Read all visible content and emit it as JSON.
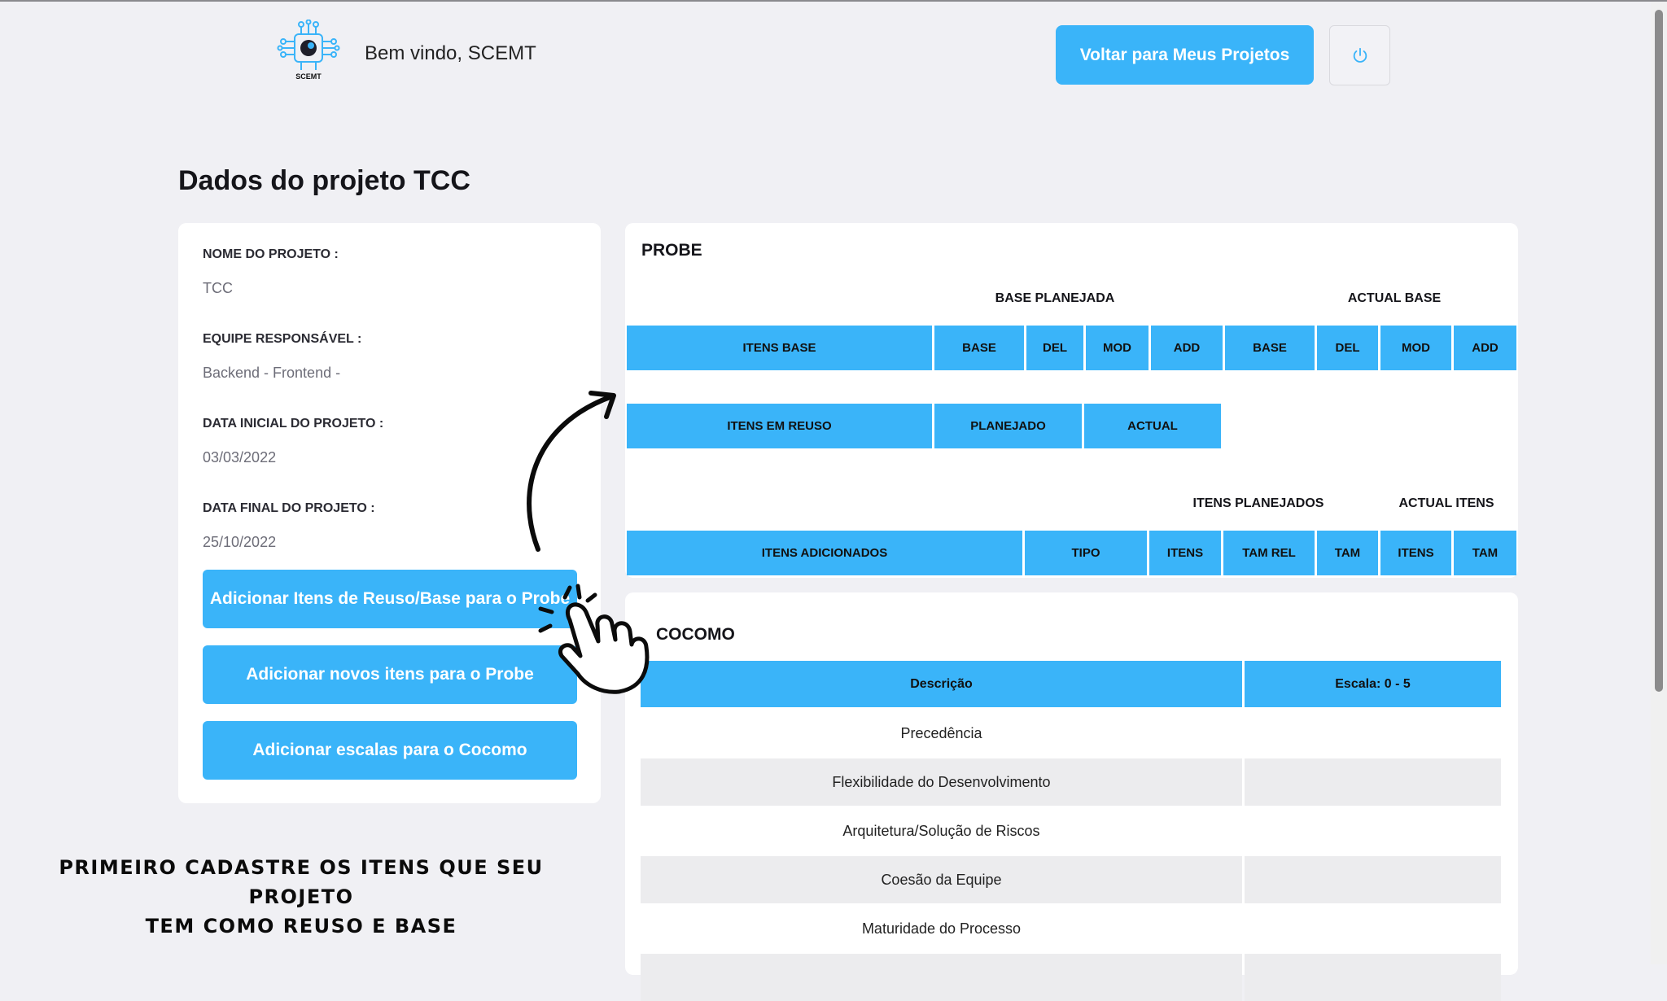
{
  "header": {
    "logo_text": "SCEMT",
    "welcome": "Bem vindo, SCEMT",
    "back_button": "Voltar para Meus Projetos",
    "power_icon": "power-icon"
  },
  "page": {
    "title": "Dados do projeto TCC"
  },
  "project": {
    "name_label": "NOME DO PROJETO :",
    "name_value": "TCC",
    "team_label": "EQUIPE RESPONSÁVEL :",
    "team_value": "Backend - Frontend -",
    "start_label": "DATA INICIAL DO PROJETO :",
    "start_value": "03/03/2022",
    "end_label": "DATA FINAL DO PROJETO :",
    "end_value": "25/10/2022",
    "buttons": {
      "reuse_base": "Adicionar Itens de Reuso/Base para o Probe",
      "new_items": "Adicionar novos itens para o Probe",
      "cocomo_scales": "Adicionar escalas para o Cocomo"
    }
  },
  "probe": {
    "title": "PROBE",
    "base_group_planned": "BASE PLANEJADA",
    "base_group_actual": "ACTUAL BASE",
    "base_headers": [
      "ITENS BASE",
      "BASE",
      "DEL",
      "MOD",
      "ADD",
      "BASE",
      "DEL",
      "MOD",
      "ADD"
    ],
    "reuse_headers": [
      "ITENS EM REUSO",
      "PLANEJADO",
      "ACTUAL"
    ],
    "added_group_planned": "ITENS PLANEJADOS",
    "added_group_actual": "ACTUAL ITENS",
    "added_headers": [
      "ITENS ADICIONADOS",
      "TIPO",
      "ITENS",
      "TAM REL",
      "TAM",
      "ITENS",
      "TAM"
    ]
  },
  "cocomo": {
    "title": "COCOMO",
    "headers": [
      "Descrição",
      "Escala: 0 - 5"
    ],
    "rows": [
      {
        "description": "Precedência",
        "scale": ""
      },
      {
        "description": "Flexibilidade do Desenvolvimento",
        "scale": ""
      },
      {
        "description": "Arquitetura/Solução de Riscos",
        "scale": ""
      },
      {
        "description": "Coesão da Equipe",
        "scale": ""
      },
      {
        "description": "Maturidade do Processo",
        "scale": ""
      }
    ]
  },
  "annotation": {
    "text_line1": "Primeiro cadastre os itens que seu projeto",
    "text_line2": "tem como reuso e base",
    "arrow_icon": "curved-arrow-icon",
    "hand_icon": "pointing-hand-icon"
  },
  "colors": {
    "accent": "#3ab4f9",
    "background": "#f0f0f4",
    "card": "#ffffff"
  }
}
